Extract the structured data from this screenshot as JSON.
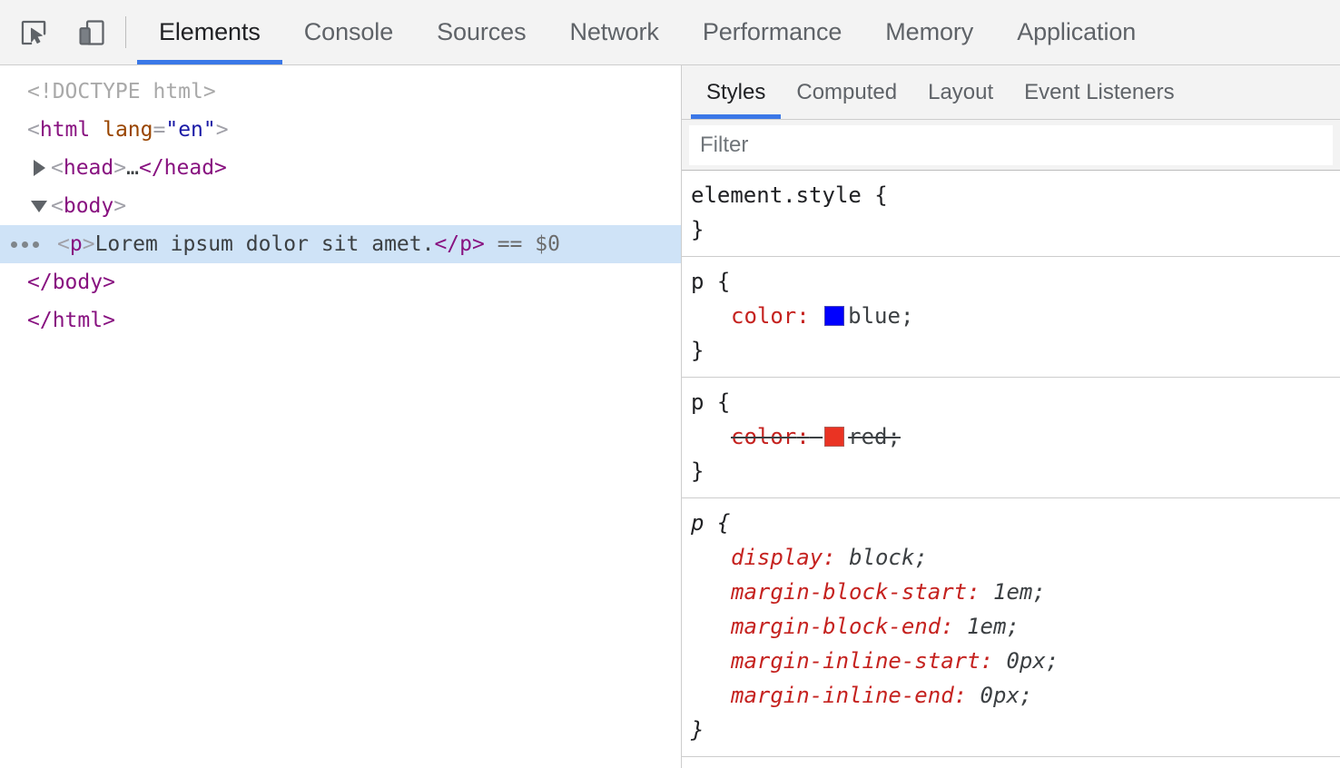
{
  "theme": {
    "accent": "#3b78e7",
    "toolbar_bg": "#f3f3f3",
    "selected_row_bg": "#cfe3f7"
  },
  "toolbar": {
    "inspect_icon": "inspect-cursor-icon",
    "device_icon": "device-toolbar-icon",
    "tabs": [
      {
        "label": "Elements",
        "active": true
      },
      {
        "label": "Console",
        "active": false
      },
      {
        "label": "Sources",
        "active": false
      },
      {
        "label": "Network",
        "active": false
      },
      {
        "label": "Performance",
        "active": false
      },
      {
        "label": "Memory",
        "active": false
      },
      {
        "label": "Application",
        "active": false
      }
    ]
  },
  "dom_tree": {
    "rows": [
      {
        "doctype": "<!DOCTYPE html>"
      },
      {
        "open_lt": "<",
        "tag": "html",
        "attr_name": "lang",
        "eq": "=",
        "attr_value": "\"en\"",
        "close_gt": ">"
      },
      {
        "twisty": "collapsed",
        "open_lt": "<",
        "tag": "head",
        "gt": ">",
        "ellipsis": "…",
        "close_tag": "</head>"
      },
      {
        "twisty": "expanded",
        "open_lt": "<",
        "tag": "body",
        "gt": ">"
      },
      {
        "selected": true,
        "badge": "three-dots",
        "open_tag_lt": "<",
        "tag": "p",
        "open_tag_gt": ">",
        "text": "Lorem ipsum dolor sit amet.",
        "close_tag": "</p>",
        "selected_marker": "== $0"
      },
      {
        "close_tag": "</body>"
      },
      {
        "close_tag": "</html>"
      }
    ]
  },
  "styles_sidebar": {
    "tabs": [
      {
        "label": "Styles",
        "active": true
      },
      {
        "label": "Computed",
        "active": false
      },
      {
        "label": "Layout",
        "active": false
      },
      {
        "label": "Event Listeners",
        "active": false
      }
    ],
    "filter": {
      "placeholder": "Filter",
      "value": ""
    },
    "rules": [
      {
        "selector": "element.style",
        "open_brace": "{",
        "close_brace": "}",
        "italic": false,
        "declarations": []
      },
      {
        "selector": "p",
        "open_brace": "{",
        "close_brace": "}",
        "italic": false,
        "declarations": [
          {
            "property": "color",
            "colon": ":",
            "swatch": "#0000ff",
            "value": "blue",
            "semicolon": ";",
            "overridden": false
          }
        ]
      },
      {
        "selector": "p",
        "open_brace": "{",
        "close_brace": "}",
        "italic": false,
        "declarations": [
          {
            "property": "color",
            "colon": ":",
            "swatch": "#ea3323",
            "value": "red",
            "semicolon": ";",
            "overridden": true
          }
        ]
      },
      {
        "selector": "p",
        "open_brace": "{",
        "close_brace": "}",
        "italic": true,
        "declarations": [
          {
            "property": "display",
            "colon": ":",
            "value": "block",
            "semicolon": ";",
            "overridden": false
          },
          {
            "property": "margin-block-start",
            "colon": ":",
            "value": "1em",
            "semicolon": ";",
            "overridden": false
          },
          {
            "property": "margin-block-end",
            "colon": ":",
            "value": "1em",
            "semicolon": ";",
            "overridden": false
          },
          {
            "property": "margin-inline-start",
            "colon": ":",
            "value": "0px",
            "semicolon": ";",
            "overridden": false
          },
          {
            "property": "margin-inline-end",
            "colon": ":",
            "value": "0px",
            "semicolon": ";",
            "overridden": false
          }
        ]
      }
    ]
  }
}
